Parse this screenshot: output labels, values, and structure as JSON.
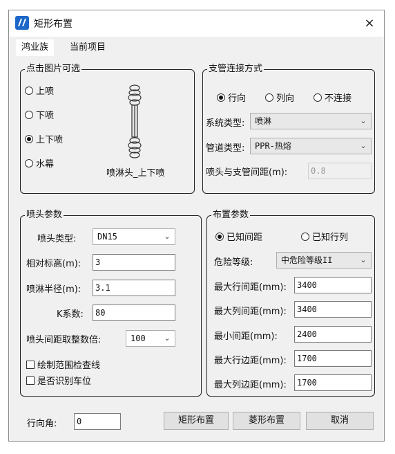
{
  "window": {
    "title": "矩形布置",
    "close": "×"
  },
  "tabs": {
    "active": "鸿业族",
    "inactive": "当前项目"
  },
  "pick_group": {
    "title": "点击图片可选",
    "options": [
      "上喷",
      "下喷",
      "上下喷",
      "水幕"
    ],
    "selected_index": 2,
    "image_caption": "喷淋头_上下喷"
  },
  "branch_group": {
    "title": "支管连接方式",
    "directions": [
      "行向",
      "列向",
      "不连接"
    ],
    "selected_index": 0,
    "system_label": "系统类型:",
    "system_value": "喷淋",
    "pipe_label": "管道类型:",
    "pipe_value": "PPR-热熔",
    "distance_label": "喷头与支管间距(m):",
    "distance_value": "0.8"
  },
  "head_group": {
    "title": "喷头参数",
    "type_label": "喷头类型:",
    "type_value": "DN15",
    "elevation_label": "相对标高(m):",
    "elevation_value": "3",
    "radius_label": "喷淋半径(m):",
    "radius_value": "3.1",
    "k_label": "K系数:",
    "k_value": "80",
    "round_label": "喷头间距取整数倍:",
    "round_value": "100",
    "check_draw_range": "绘制范围检查线",
    "check_parking": "是否识别车位"
  },
  "layout_group": {
    "title": "布置参数",
    "modes": [
      "已知间距",
      "已知行列"
    ],
    "selected_index": 0,
    "hazard_label": "危险等级:",
    "hazard_value": "中危险等级II",
    "max_row_spacing_label": "最大行间距(mm):",
    "max_row_spacing_value": "3400",
    "max_col_spacing_label": "最大列间距(mm):",
    "max_col_spacing_value": "3400",
    "min_spacing_label": "最小间距(mm):",
    "min_spacing_value": "2400",
    "max_row_edge_label": "最大行边距(mm):",
    "max_row_edge_value": "1700",
    "max_col_edge_label": "最大列边距(mm):",
    "max_col_edge_value": "1700"
  },
  "footer": {
    "angle_label": "行向角:",
    "angle_value": "0",
    "rect_button": "矩形布置",
    "diamond_button": "菱形布置",
    "cancel_button": "取消"
  },
  "icons": {
    "app": "app-logo-icon",
    "close": "close-icon",
    "dropdown": "chevron-down-icon",
    "sprinkler": "sprinkler-head-icon"
  }
}
